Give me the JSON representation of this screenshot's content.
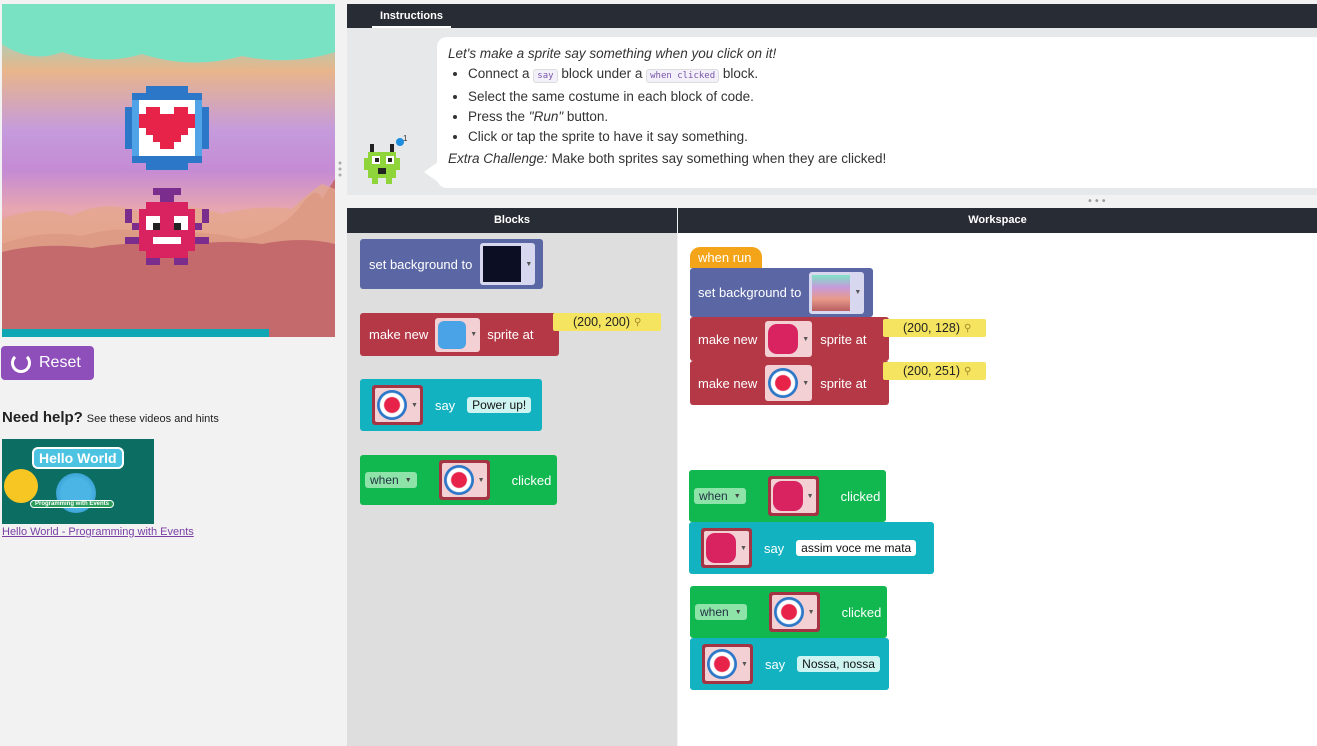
{
  "stage": {
    "reset_label": "Reset"
  },
  "help": {
    "title": "Need help?",
    "subtitle": "See these videos and hints",
    "video_title": "Hello World",
    "video_sub": "Programming with Events",
    "video_link": "Hello World - Programming with Events"
  },
  "instructions": {
    "tab": "Instructions",
    "intro": "Let's make a sprite say something when you click on it!",
    "bullets": [
      {
        "pre": "Connect a ",
        "code1": "say",
        "mid": " block under a ",
        "code2": "when clicked",
        "post": " block."
      },
      {
        "text": "Select the same costume in each block of code."
      },
      {
        "pre": "Press the ",
        "em": "\"Run\"",
        "post": " button."
      },
      {
        "text": "Click or tap the sprite to have it say something."
      }
    ],
    "extra_label": "Extra Challenge:",
    "extra_text": " Make both sprites say something when they are clicked!",
    "badge": "1"
  },
  "panels": {
    "blocks": "Blocks",
    "workspace": "Workspace"
  },
  "toolbox": {
    "set_background": "set background to",
    "make_new": "make new",
    "sprite_at": "sprite at",
    "coord": "(200, 200)",
    "say": "say",
    "say_text": "Power up!",
    "when": "when",
    "clicked": "clicked"
  },
  "workspace": {
    "when_run": "when run",
    "set_background": "set background to",
    "make_new_1": "make new",
    "sprite_at_1": "sprite at",
    "coord_1": "(200, 128)",
    "make_new_2": "make new",
    "sprite_at_2": "sprite at",
    "coord_2": "(200, 251)",
    "when_1": "when",
    "clicked_1": "clicked",
    "say_1": "say",
    "say_text_1": "assim voce me mata",
    "when_2": "when",
    "clicked_2": "clicked",
    "say_2": "say",
    "say_text_2": "Nossa, nossa"
  }
}
